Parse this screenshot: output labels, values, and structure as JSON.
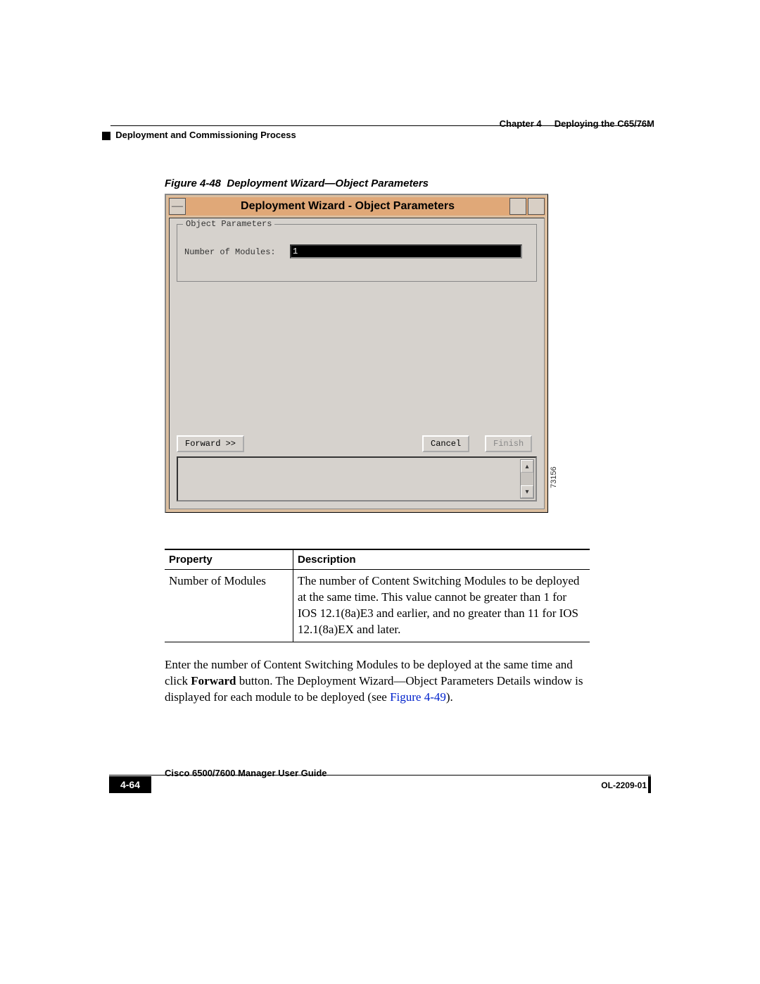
{
  "header": {
    "chapter": "Chapter 4",
    "chapter_title": "Deploying the C65/76M",
    "section": "Deployment and Commissioning Process"
  },
  "figure": {
    "label": "Figure 4-48",
    "title": "Deployment Wizard—Object Parameters",
    "id_label": "73156"
  },
  "wizard": {
    "window_title": "Deployment Wizard - Object Parameters",
    "group_label": "Object Parameters",
    "field_label": "Number of Modules:",
    "field_value": "1",
    "forward_label": "Forward >>",
    "cancel_label": "Cancel",
    "finish_label": "Finish"
  },
  "table": {
    "headers": {
      "prop": "Property",
      "desc": "Description"
    },
    "rows": [
      {
        "prop": "Number of Modules",
        "desc": "The number of Content Switching Modules to be deployed at the same time. This value cannot be greater than 1 for IOS 12.1(8a)E3 and earlier, and no greater than 11 for IOS 12.1(8a)EX and later."
      }
    ]
  },
  "paragraph": {
    "p1a": "Enter the number of Content Switching Modules to be deployed at the same time and click ",
    "p1b": "Forward",
    "p1c": " button. The Deployment Wizard—Object Parameters Details window is displayed for each module to be deployed (see ",
    "xref": "Figure 4-49",
    "p1d": ")."
  },
  "footer": {
    "guide": "Cisco 6500/7600 Manager User Guide",
    "page": "4-64",
    "docid": "OL-2209-01"
  }
}
